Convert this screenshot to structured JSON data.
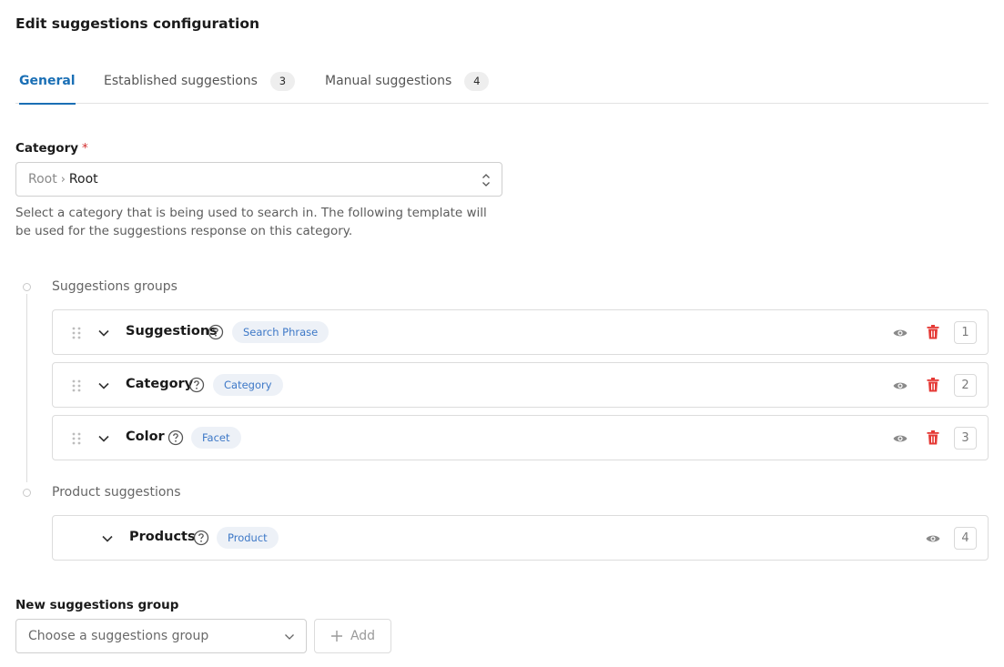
{
  "page": {
    "title": "Edit suggestions configuration"
  },
  "tabs": [
    {
      "label": "General",
      "active": true
    },
    {
      "label": "Established suggestions",
      "count": "3"
    },
    {
      "label": "Manual suggestions",
      "count": "4"
    }
  ],
  "category": {
    "label": "Category",
    "required_mark": "*",
    "path_root": "Root",
    "path_separator": "›",
    "value": "Root",
    "help": "Select a category that is being used to search in. The following template will be used for the suggestions response on this category."
  },
  "sections": {
    "groups_label": "Suggestions groups",
    "products_label": "Product suggestions"
  },
  "groups": [
    {
      "name": "Suggestions",
      "tag": "Search Phrase",
      "position": "1",
      "visible_icon": "eye-icon",
      "delete_icon": "trash-icon"
    },
    {
      "name": "Category",
      "tag": "Category",
      "position": "2",
      "visible_icon": "eye-icon",
      "delete_icon": "trash-icon"
    },
    {
      "name": "Color",
      "tag": "Facet",
      "position": "3",
      "visible_icon": "eye-icon",
      "delete_icon": "trash-icon"
    }
  ],
  "product_group": {
    "name": "Products",
    "tag": "Product",
    "position": "4",
    "visible_icon": "eye-icon"
  },
  "new_group": {
    "label": "New suggestions group",
    "placeholder": "Choose a suggestions group",
    "add_label": "Add"
  },
  "colors": {
    "accent": "#1a6fb5",
    "tag_bg": "#edf1f7",
    "tag_text": "#3d78c7",
    "delete": "#e53935",
    "required": "#d32f2f"
  }
}
